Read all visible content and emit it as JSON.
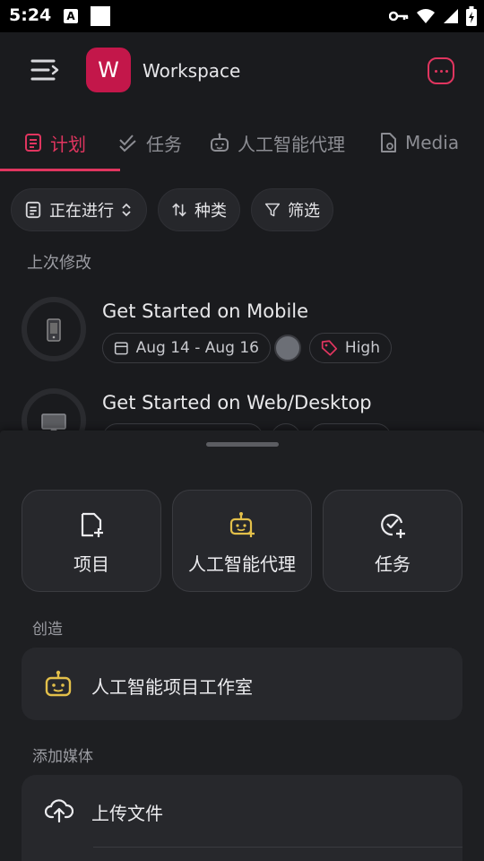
{
  "status_bar": {
    "time": "5:24",
    "notification_icon_letter": "A",
    "icons": [
      "vpn-key-icon",
      "wifi-icon",
      "signal-icon",
      "battery-charging-icon"
    ]
  },
  "header": {
    "workspace_initial": "W",
    "workspace_name": "Workspace",
    "avatar_color": "#c3174a",
    "accent_color": "#e0355f"
  },
  "tabs": [
    {
      "label": "计划",
      "icon": "plan-icon",
      "active": true
    },
    {
      "label": "任务",
      "icon": "checkmarks-icon",
      "active": false
    },
    {
      "label": "人工智能代理",
      "icon": "robot-icon",
      "active": false
    },
    {
      "label": "Media",
      "icon": "media-file-icon",
      "active": false
    }
  ],
  "filters": {
    "status": "正在进行",
    "sort": "种类",
    "filter": "筛选"
  },
  "list": {
    "section_label": "上次修改",
    "items": [
      {
        "title": "Get Started on Mobile",
        "date_range": "Aug 14 - Aug 16",
        "priority": "High",
        "icon": "phone-icon"
      },
      {
        "title": "Get Started on Web/Desktop",
        "icon": "monitor-icon"
      }
    ]
  },
  "sheet": {
    "tiles": [
      {
        "label": "项目",
        "icon": "new-project-icon"
      },
      {
        "label": "人工智能代理",
        "icon": "add-robot-icon"
      },
      {
        "label": "任务",
        "icon": "add-task-icon"
      }
    ],
    "create_section": {
      "label": "创造",
      "item": "人工智能项目工作室"
    },
    "media_section": {
      "label": "添加媒体",
      "upload_item": "上传文件"
    }
  }
}
